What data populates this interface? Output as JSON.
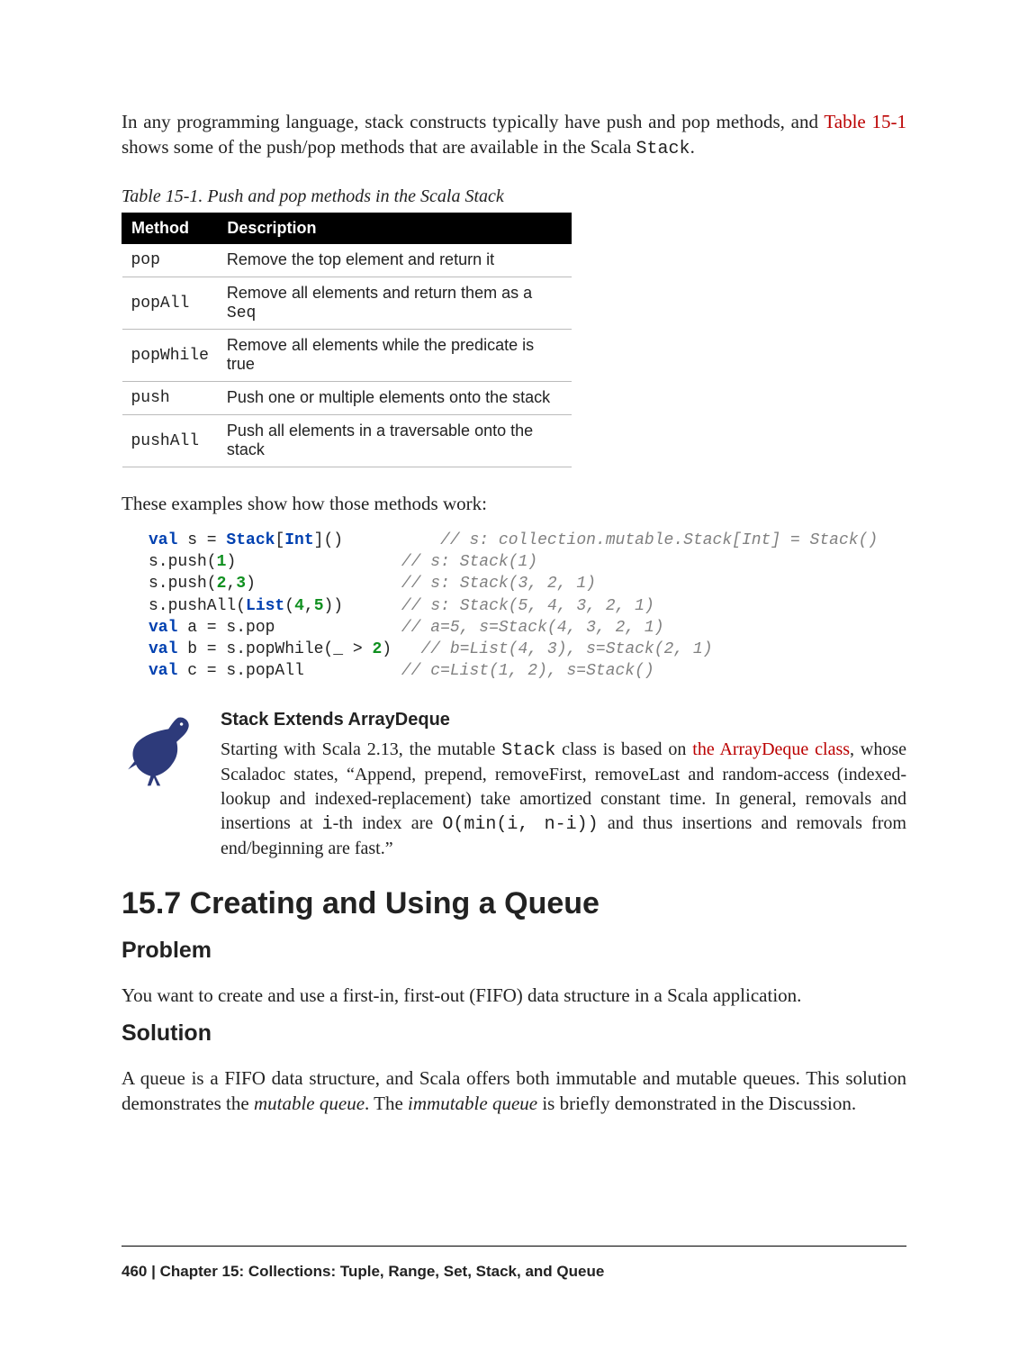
{
  "intro": {
    "part1": "In any programming language, stack constructs typically have push and pop methods, and ",
    "link": "Table 15-1",
    "part2": " shows some of the push/pop methods that are available in the Scala ",
    "code": "Stack",
    "part3": "."
  },
  "table": {
    "caption": "Table 15-1. Push and pop methods in the Scala Stack",
    "headers": {
      "method": "Method",
      "description": "Description"
    },
    "rows": [
      {
        "method": "pop",
        "desc_pre": "Remove the top element and return it",
        "code": "",
        "desc_post": ""
      },
      {
        "method": "popAll",
        "desc_pre": "Remove all elements and return them as a ",
        "code": "Seq",
        "desc_post": ""
      },
      {
        "method": "popWhile",
        "desc_pre": "Remove all elements while the predicate is true",
        "code": "",
        "desc_post": ""
      },
      {
        "method": "push",
        "desc_pre": "Push one or multiple elements onto the stack",
        "code": "",
        "desc_post": ""
      },
      {
        "method": "pushAll",
        "desc_pre": "Push all elements in a traversable onto the stack",
        "code": "",
        "desc_post": ""
      }
    ]
  },
  "examples_intro": "These examples show how those methods work:",
  "code": {
    "l1": {
      "a": "val",
      "b": " s = ",
      "c": "Stack",
      "d": "[",
      "e": "Int",
      "f": "]()          ",
      "g": "// s: collection.mutable.Stack[Int] = Stack()"
    },
    "l2": {
      "a": "s.push(",
      "b": "1",
      "c": ")                 ",
      "d": "// s: Stack(1)"
    },
    "l3": {
      "a": "s.push(",
      "b": "2",
      "c": ",",
      "d": "3",
      "e": ")               ",
      "f": "// s: Stack(3, 2, 1)"
    },
    "l4": {
      "a": "s.pushAll(",
      "b": "List",
      "c": "(",
      "d": "4",
      "e": ",",
      "f": "5",
      "g": "))      ",
      "h": "// s: Stack(5, 4, 3, 2, 1)"
    },
    "l5": {
      "a": "val",
      "b": " a = s.pop             ",
      "c": "// a=5, s=Stack(4, 3, 2, 1)"
    },
    "l6": {
      "a": "val",
      "b": " b = s.popWhile(_ > ",
      "c": "2",
      "d": ")   ",
      "e": "// b=List(4, 3), s=Stack(2, 1)"
    },
    "l7": {
      "a": "val",
      "b": " c = s.popAll          ",
      "c": "// c=List(1, 2), s=Stack()"
    }
  },
  "note": {
    "title": "Stack Extends ArrayDeque",
    "p1": "Starting with Scala 2.13, the mutable ",
    "c1": "Stack",
    "p2": " class is based on ",
    "link": "the ArrayDeque class",
    "p3": ", whose Scaladoc states, “Append, prepend, removeFirst, removeLast and random-access (indexed-lookup and indexed-replacement) take amortized constant time. In general, removals and insertions at ",
    "c2": "i",
    "p4": "-th index are ",
    "c3": "O(min(i, n-i))",
    "p5": " and thus insertions and removals from end/beginning are fast.”"
  },
  "section": {
    "title": "15.7 Creating and Using a Queue",
    "problem_h": "Problem",
    "problem_t": "You want to create and use a first-in, first-out (FIFO) data structure in a Scala application.",
    "solution_h": "Solution",
    "solution": {
      "p1": "A queue is a FIFO data structure, and Scala offers both immutable and mutable queues. This solution demonstrates the ",
      "e1": "mutable queue",
      "p2": ". The ",
      "e2": "immutable queue",
      "p3": " is briefly demonstrated in the Discussion."
    }
  },
  "footer": {
    "page": "460",
    "sep": "   |   ",
    "chapter": "Chapter 15: Collections: Tuple, Range, Set, Stack, and Queue"
  }
}
